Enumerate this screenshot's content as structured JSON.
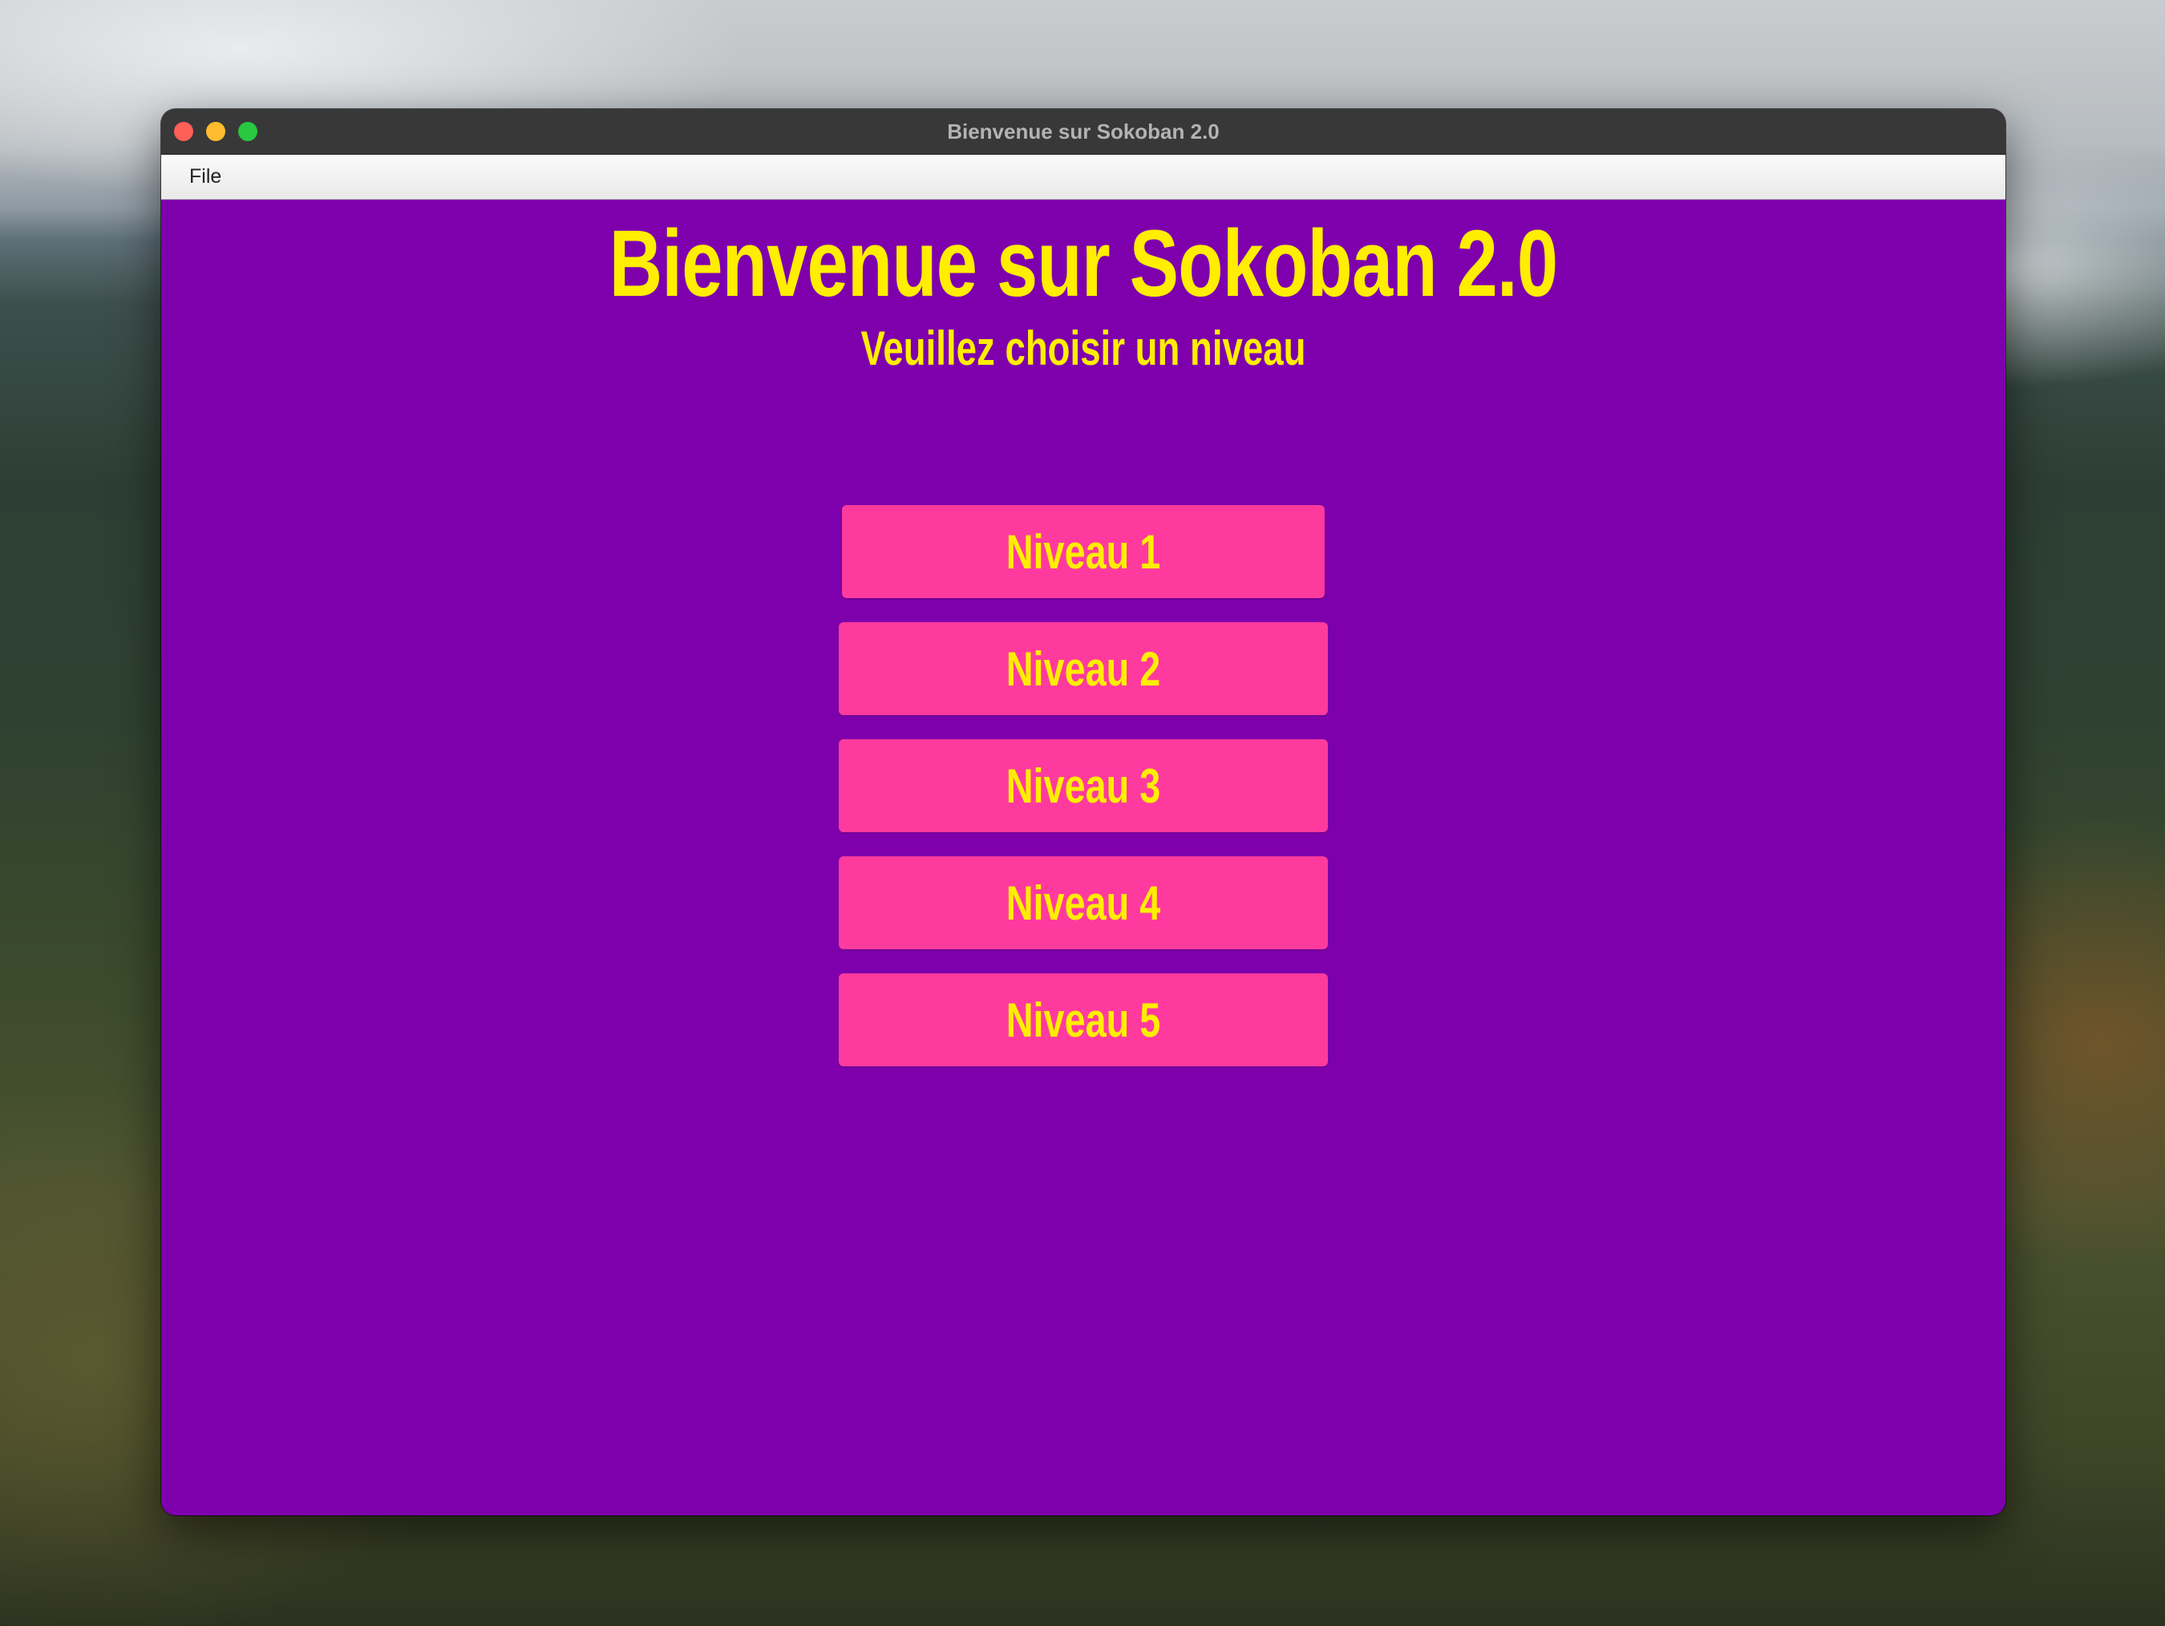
{
  "window": {
    "title": "Bienvenue sur Sokoban 2.0"
  },
  "menubar": {
    "items": [
      {
        "label": "File"
      }
    ]
  },
  "main": {
    "title": "Bienvenue sur Sokoban 2.0",
    "subtitle": "Veuillez choisir un niveau",
    "levels": [
      {
        "label": "Niveau 1"
      },
      {
        "label": "Niveau 2"
      },
      {
        "label": "Niveau 3"
      },
      {
        "label": "Niveau 4"
      },
      {
        "label": "Niveau 5"
      }
    ]
  },
  "colors": {
    "background": "#7e00ad",
    "button": "#ff3a9e",
    "text": "#ffee00"
  }
}
